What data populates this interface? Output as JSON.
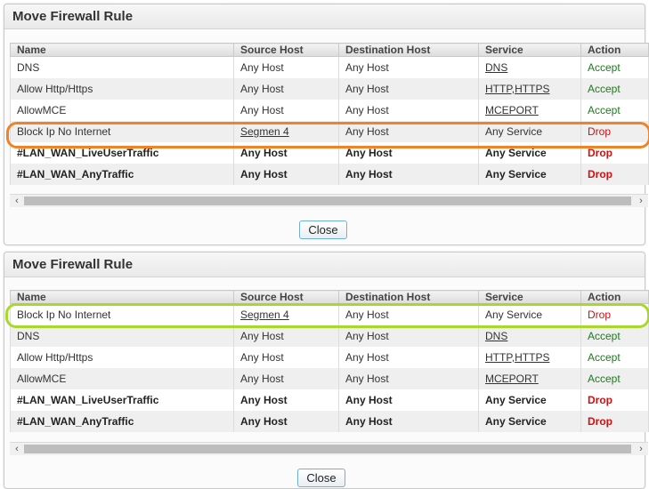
{
  "dialogs": [
    {
      "title": "Move Firewall Rule",
      "columns": [
        "Name",
        "Source Host",
        "Destination Host",
        "Service",
        "Action"
      ],
      "rows": [
        {
          "name": "DNS",
          "source": "Any Host",
          "destination": "Any Host",
          "service": "DNS",
          "action": "Accept"
        },
        {
          "name": "Allow Http/Https",
          "source": "Any Host",
          "destination": "Any Host",
          "service": "HTTP,HTTPS",
          "action": "Accept"
        },
        {
          "name": "AllowMCE",
          "source": "Any Host",
          "destination": "Any Host",
          "service": "MCEPORT",
          "action": "Accept"
        },
        {
          "name": "Block Ip No Internet",
          "source": "Segmen 4",
          "destination": "Any Host",
          "service": "Any Service",
          "action": "Drop"
        },
        {
          "name": "#LAN_WAN_LiveUserTraffic",
          "source": "Any Host",
          "destination": "Any Host",
          "service": "Any Service",
          "action": "Drop"
        },
        {
          "name": "#LAN_WAN_AnyTraffic",
          "source": "Any Host",
          "destination": "Any Host",
          "service": "Any Service",
          "action": "Drop"
        }
      ],
      "scroll_left": "‹",
      "scroll_right": "›",
      "close_label": "Close"
    },
    {
      "title": "Move Firewall Rule",
      "columns": [
        "Name",
        "Source Host",
        "Destination Host",
        "Service",
        "Action"
      ],
      "rows": [
        {
          "name": "Block Ip No Internet",
          "source": "Segmen 4",
          "destination": "Any Host",
          "service": "Any Service",
          "action": "Drop"
        },
        {
          "name": "DNS",
          "source": "Any Host",
          "destination": "Any Host",
          "service": "DNS",
          "action": "Accept"
        },
        {
          "name": "Allow Http/Https",
          "source": "Any Host",
          "destination": "Any Host",
          "service": "HTTP,HTTPS",
          "action": "Accept"
        },
        {
          "name": "AllowMCE",
          "source": "Any Host",
          "destination": "Any Host",
          "service": "MCEPORT",
          "action": "Accept"
        },
        {
          "name": "#LAN_WAN_LiveUserTraffic",
          "source": "Any Host",
          "destination": "Any Host",
          "service": "Any Service",
          "action": "Drop"
        },
        {
          "name": "#LAN_WAN_AnyTraffic",
          "source": "Any Host",
          "destination": "Any Host",
          "service": "Any Service",
          "action": "Drop"
        }
      ],
      "scroll_left": "‹",
      "scroll_right": "›",
      "close_label": "Close"
    }
  ],
  "colors": {
    "accept": "#1f7a1f",
    "drop": "#cc1111",
    "highlight_before": "#f08326",
    "highlight_after": "#a9d82a"
  }
}
